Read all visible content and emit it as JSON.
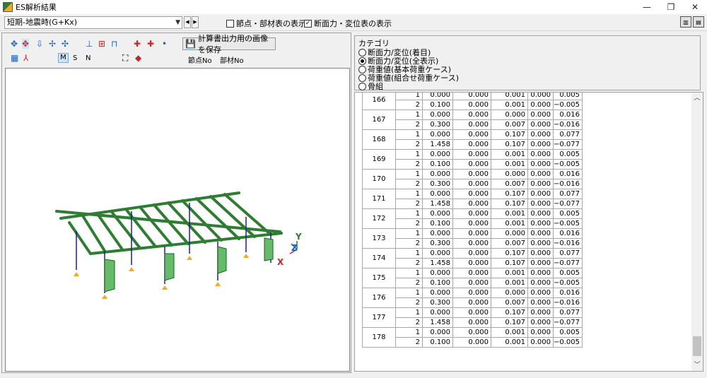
{
  "window": {
    "title": "ES解析結果",
    "minimize": "—",
    "maximize": "❐",
    "close": "✕"
  },
  "toolbar": {
    "case_select": "短期-地震時(G+Kx)",
    "show_node_member": "節点・部材表の表示",
    "show_section_force": "断面力・変位表の表示",
    "show_node_member_checked": false,
    "show_section_force_checked": true
  },
  "left": {
    "save_button": "計算書出力用の画像を保存",
    "mode_m": "M",
    "mode_s": "S",
    "mode_n": "N",
    "node_no": "節点No",
    "member_no": "部材No",
    "axis_x": "X",
    "axis_y": "Y",
    "axis_z": "Z"
  },
  "category": {
    "title": "カテゴリ",
    "options": [
      {
        "label": "断面力/変位(着目)",
        "selected": false
      },
      {
        "label": "断面力/変位(全表示)",
        "selected": true
      },
      {
        "label": "荷重値(基本荷重ケース)",
        "selected": false
      },
      {
        "label": "荷重値(組合せ荷重ケース)",
        "selected": false
      },
      {
        "label": "骨組",
        "selected": false
      }
    ]
  },
  "table": {
    "rows": [
      {
        "id": "166",
        "r1": [
          "1",
          "0.000",
          "0.000",
          "0.001",
          "0.000",
          "0.005"
        ],
        "r2": [
          "2",
          "0.100",
          "0.000",
          "0.001",
          "0.000",
          "−0.005"
        ]
      },
      {
        "id": "167",
        "r1": [
          "1",
          "0.000",
          "0.000",
          "0.000",
          "0.000",
          "0.016"
        ],
        "r2": [
          "2",
          "0.300",
          "0.000",
          "0.007",
          "0.000",
          "−0.016"
        ]
      },
      {
        "id": "168",
        "r1": [
          "1",
          "0.000",
          "0.000",
          "0.107",
          "0.000",
          "0.077"
        ],
        "r2": [
          "2",
          "1.458",
          "0.000",
          "0.107",
          "0.000",
          "−0.077"
        ]
      },
      {
        "id": "169",
        "r1": [
          "1",
          "0.000",
          "0.000",
          "0.001",
          "0.000",
          "0.005"
        ],
        "r2": [
          "2",
          "0.100",
          "0.000",
          "0.001",
          "0.000",
          "−0.005"
        ]
      },
      {
        "id": "170",
        "r1": [
          "1",
          "0.000",
          "0.000",
          "0.000",
          "0.000",
          "0.016"
        ],
        "r2": [
          "2",
          "0.300",
          "0.000",
          "0.007",
          "0.000",
          "−0.016"
        ]
      },
      {
        "id": "171",
        "r1": [
          "1",
          "0.000",
          "0.000",
          "0.107",
          "0.000",
          "0.077"
        ],
        "r2": [
          "2",
          "1.458",
          "0.000",
          "0.107",
          "0.000",
          "−0.077"
        ]
      },
      {
        "id": "172",
        "r1": [
          "1",
          "0.000",
          "0.000",
          "0.001",
          "0.000",
          "0.005"
        ],
        "r2": [
          "2",
          "0.100",
          "0.000",
          "0.001",
          "0.000",
          "−0.005"
        ]
      },
      {
        "id": "173",
        "r1": [
          "1",
          "0.000",
          "0.000",
          "0.000",
          "0.000",
          "0.016"
        ],
        "r2": [
          "2",
          "0.300",
          "0.000",
          "0.007",
          "0.000",
          "−0.016"
        ]
      },
      {
        "id": "174",
        "r1": [
          "1",
          "0.000",
          "0.000",
          "0.107",
          "0.000",
          "0.077"
        ],
        "r2": [
          "2",
          "1.458",
          "0.000",
          "0.107",
          "0.000",
          "−0.077"
        ]
      },
      {
        "id": "175",
        "r1": [
          "1",
          "0.000",
          "0.000",
          "0.001",
          "0.000",
          "0.005"
        ],
        "r2": [
          "2",
          "0.100",
          "0.000",
          "0.001",
          "0.000",
          "−0.005"
        ]
      },
      {
        "id": "176",
        "r1": [
          "1",
          "0.000",
          "0.000",
          "0.000",
          "0.000",
          "0.016"
        ],
        "r2": [
          "2",
          "0.300",
          "0.000",
          "0.007",
          "0.000",
          "−0.016"
        ]
      },
      {
        "id": "177",
        "r1": [
          "1",
          "0.000",
          "0.000",
          "0.107",
          "0.000",
          "0.077"
        ],
        "r2": [
          "2",
          "1.458",
          "0.000",
          "0.107",
          "0.000",
          "−0.077"
        ]
      },
      {
        "id": "178",
        "r1": [
          "1",
          "0.000",
          "0.000",
          "0.001",
          "0.000",
          "0.005"
        ],
        "r2": [
          "2",
          "0.100",
          "0.000",
          "0.001",
          "0.000",
          "−0.005"
        ]
      }
    ]
  }
}
